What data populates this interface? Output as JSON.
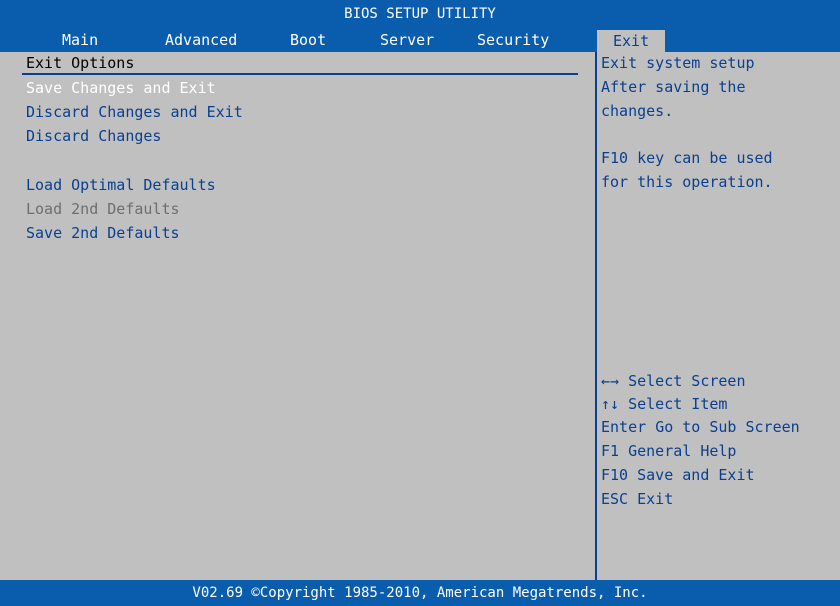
{
  "title": "BIOS SETUP UTILITY",
  "tabs": [
    {
      "label": "Main"
    },
    {
      "label": "Advanced"
    },
    {
      "label": "Boot"
    },
    {
      "label": "Server"
    },
    {
      "label": "Security"
    },
    {
      "label": "Exit",
      "active": true
    }
  ],
  "main": {
    "section_title": "Exit Options",
    "options": [
      {
        "label": "Save Changes and Exit",
        "state": "selected"
      },
      {
        "label": "Discard Changes and Exit",
        "state": "normal"
      },
      {
        "label": "Discard Changes",
        "state": "normal"
      },
      {
        "label": "Load Optimal Defaults",
        "state": "normal"
      },
      {
        "label": "Load 2nd Defaults",
        "state": "disabled"
      },
      {
        "label": "Save 2nd Defaults",
        "state": "normal"
      }
    ]
  },
  "help": {
    "description": [
      "Exit system setup",
      "After saving the",
      "changes.",
      "",
      "F10 key can be used",
      "for this operation."
    ],
    "keys": [
      {
        "key": "←→",
        "action": "Select Screen"
      },
      {
        "key": "↑↓",
        "action": "Select Item"
      },
      {
        "key": "Enter",
        "action": "Go to Sub Screen"
      },
      {
        "key": "F1",
        "action": "General Help"
      },
      {
        "key": "F10",
        "action": "Save and Exit"
      },
      {
        "key": "ESC",
        "action": "Exit"
      }
    ]
  },
  "footer": "V02.69 ©Copyright 1985-2010, American Megatrends, Inc.",
  "colors": {
    "blue_bar": "#0a5cad",
    "panel_gray": "#c0c0c0",
    "text_blue": "#0a3f8f",
    "selected_white": "#ffffff",
    "disabled_gray": "#6e6e6e"
  }
}
